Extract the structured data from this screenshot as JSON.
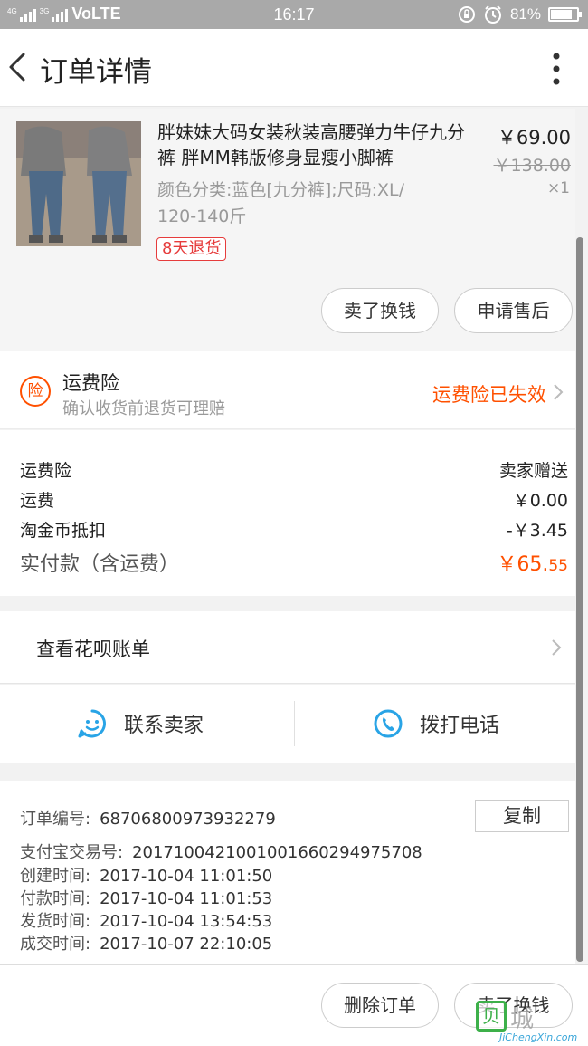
{
  "status_bar": {
    "network_small": "4G",
    "network_small2": "3G",
    "carrier": "VoLTE",
    "time": "16:17",
    "battery": "81%",
    "battery_level": 0.81
  },
  "nav": {
    "title": "订单详情"
  },
  "product": {
    "name": "胖妹妹大码女装秋装高腰弹力牛仔九分裤 胖MM韩版修身显瘦小脚裤",
    "sku": "颜色分类:蓝色[九分裤];尺码:XL/ 120-140斤",
    "price": "￥69.00",
    "original_price": "￥138.00",
    "quantity": "×1",
    "return_badge": "8天退货",
    "btn_sell": "卖了换钱",
    "btn_after_sale": "申请售后"
  },
  "insurance": {
    "icon_char": "险",
    "title": "运费险",
    "subtitle": "确认收货前退货可理赔",
    "status": "运费险已失效"
  },
  "fees": {
    "rows": [
      {
        "label": "运费险",
        "value": "卖家赠送"
      },
      {
        "label": "运费",
        "value": "￥0.00"
      },
      {
        "label": "淘金币抵扣",
        "value": "-￥3.45"
      }
    ],
    "total_label": "实付款（含运费）",
    "total_main": "￥65.",
    "total_cents": "55"
  },
  "huabei": {
    "label": "查看花呗账单"
  },
  "contact": {
    "seller": "联系卖家",
    "phone": "拨打电话"
  },
  "order_info": {
    "copy_label": "复制",
    "items": [
      {
        "label": "订单编号:",
        "value": "68706800973932279"
      },
      {
        "label": "支付宝交易号:",
        "value": "2017100421001001660294975708"
      },
      {
        "label": "创建时间:",
        "value": "2017-10-04 11:01:50"
      },
      {
        "label": "付款时间:",
        "value": "2017-10-04 11:01:53"
      },
      {
        "label": "发货时间:",
        "value": "2017-10-04 13:54:53"
      },
      {
        "label": "成交时间:",
        "value": "2017-10-07 22:10:05"
      }
    ]
  },
  "bottom": {
    "delete_order": "删除订单",
    "sell": "卖了换钱"
  },
  "watermark": {
    "box_char": "贝",
    "cn": "城",
    "en": "JiChengXin.com"
  },
  "colors": {
    "accent": "#ff5000",
    "icon_blue": "#29a4e6",
    "badge_red": "#e63c3c",
    "statusbar": "#a9a9a9"
  }
}
